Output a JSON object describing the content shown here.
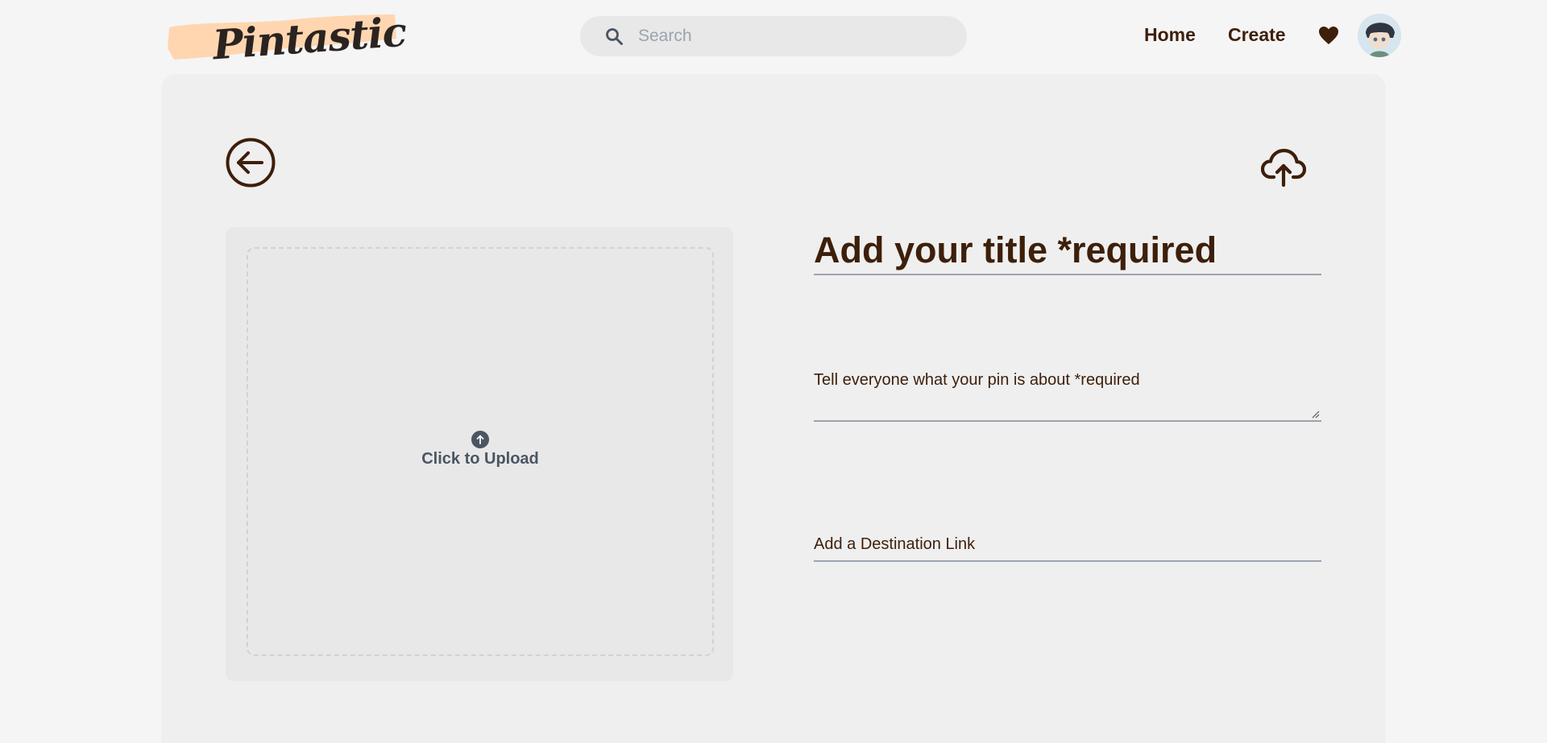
{
  "header": {
    "logo_text": "Pintastic",
    "search": {
      "placeholder": "Search",
      "value": ""
    },
    "nav": {
      "home": "Home",
      "create": "Create"
    }
  },
  "form": {
    "upload_label": "Click to Upload",
    "title": {
      "placeholder": "Add your title *required",
      "value": ""
    },
    "description": {
      "placeholder": "Tell everyone what your pin is about *required",
      "value": ""
    },
    "link": {
      "placeholder": "Add a Destination Link",
      "value": ""
    }
  },
  "icons": {
    "back": "arrow-left-circle-icon",
    "upload": "cloud-upload-icon",
    "search": "search-icon",
    "favorites": "heart-icon",
    "dropzone": "arrow-up-circle-icon"
  },
  "colors": {
    "brand_brown": "#3d1f0a",
    "logo_swash": "#ffd6b0",
    "background": "#f5f5f5",
    "card": "#efefef"
  }
}
